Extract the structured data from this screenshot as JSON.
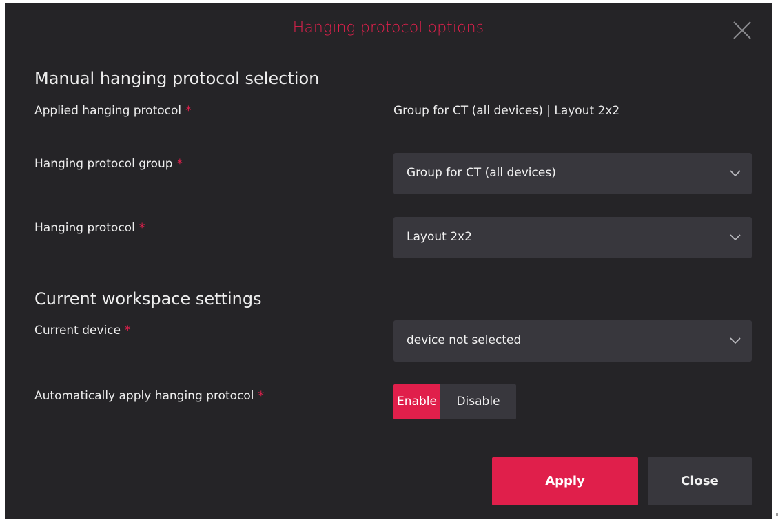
{
  "dialog": {
    "title": "Hanging protocol options",
    "close_icon": "close-icon",
    "accent_color": "#e0204c",
    "background_color": "#252427"
  },
  "manual": {
    "section_title": "Manual hanging protocol selection",
    "applied": {
      "label": "Applied hanging protocol",
      "required": "*",
      "value": "Group for CT (all devices) | Layout 2x2"
    },
    "group": {
      "label": "Hanging protocol group",
      "required": "*",
      "selected": "Group for CT (all devices)"
    },
    "protocol": {
      "label": "Hanging protocol",
      "required": "*",
      "selected": "Layout 2x2"
    }
  },
  "workspace": {
    "section_title": "Current workspace settings",
    "device": {
      "label": "Current device",
      "required": "*",
      "selected": "device not selected"
    },
    "auto_apply": {
      "label": "Automatically apply hanging protocol",
      "required": "*",
      "enable_label": "Enable",
      "disable_label": "Disable",
      "selected": "Enable"
    }
  },
  "footer": {
    "apply_label": "Apply",
    "close_label": "Close"
  }
}
